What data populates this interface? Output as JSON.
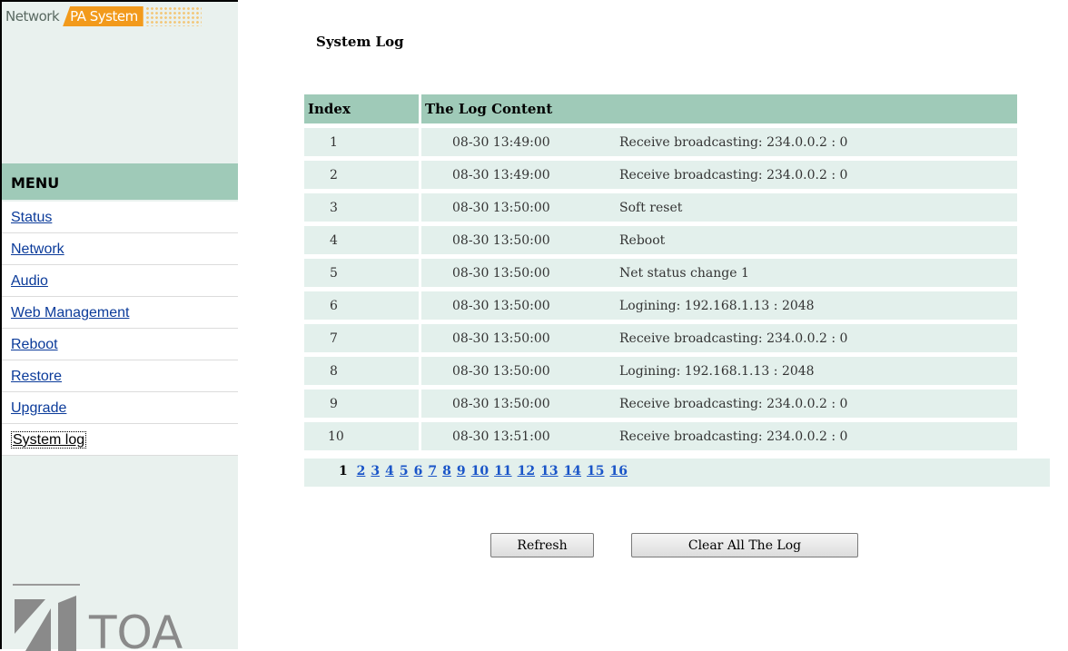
{
  "brand": {
    "part1": "Network",
    "part2": "PA System"
  },
  "sidebar": {
    "menu_title": "MENU",
    "items": [
      {
        "label": "Status"
      },
      {
        "label": "Network"
      },
      {
        "label": "Audio"
      },
      {
        "label": "Web Management"
      },
      {
        "label": "Reboot"
      },
      {
        "label": "Restore"
      },
      {
        "label": "Upgrade"
      },
      {
        "label": "System log",
        "active": true
      }
    ],
    "logo_text": "TOA"
  },
  "main": {
    "title": "System Log",
    "table": {
      "headers": [
        "Index",
        "The Log Content"
      ],
      "rows": [
        {
          "index": "1",
          "time": "08-30 13:49:00",
          "message": "Receive broadcasting: 234.0.0.2 : 0"
        },
        {
          "index": "2",
          "time": "08-30 13:49:00",
          "message": "Receive broadcasting: 234.0.0.2 : 0"
        },
        {
          "index": "3",
          "time": "08-30 13:50:00",
          "message": "Soft reset"
        },
        {
          "index": "4",
          "time": "08-30 13:50:00",
          "message": "Reboot"
        },
        {
          "index": "5",
          "time": "08-30 13:50:00",
          "message": "Net status change 1"
        },
        {
          "index": "6",
          "time": "08-30 13:50:00",
          "message": "Logining: 192.168.1.13 : 2048"
        },
        {
          "index": "7",
          "time": "08-30 13:50:00",
          "message": "Receive broadcasting: 234.0.0.2 : 0"
        },
        {
          "index": "8",
          "time": "08-30 13:50:00",
          "message": "Logining: 192.168.1.13 : 2048"
        },
        {
          "index": "9",
          "time": "08-30 13:50:00",
          "message": "Receive broadcasting: 234.0.0.2 : 0"
        },
        {
          "index": "10",
          "time": "08-30 13:51:00",
          "message": "Receive broadcasting: 234.0.0.2 : 0"
        }
      ]
    },
    "pagination": {
      "current": "1",
      "pages": [
        "2",
        "3",
        "4",
        "5",
        "6",
        "7",
        "8",
        "9",
        "10",
        "11",
        "12",
        "13",
        "14",
        "15",
        "16"
      ]
    },
    "buttons": {
      "refresh": "Refresh",
      "clear": "Clear All The Log"
    }
  },
  "colors": {
    "sidebar_bg": "#e9f1ee",
    "header_green": "#9fcab8",
    "row_bg": "#e3f0ec",
    "brand_orange": "#f29a1b",
    "link_blue": "#1a55c8"
  }
}
